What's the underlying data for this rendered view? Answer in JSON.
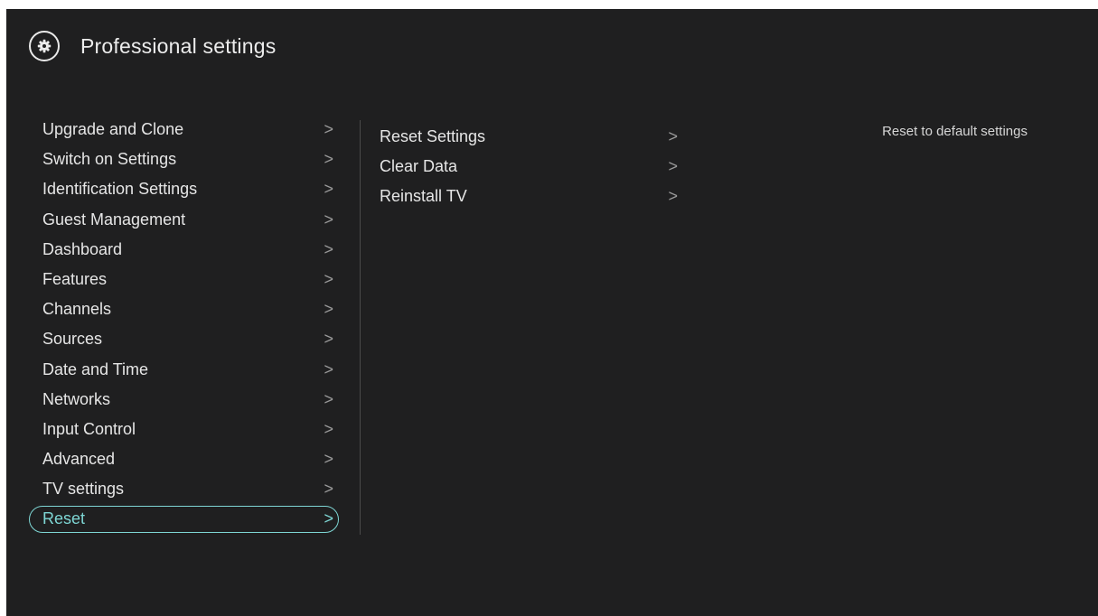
{
  "header": {
    "title": "Professional settings",
    "icon": "gear-icon"
  },
  "menu": {
    "items": [
      {
        "label": "Upgrade and Clone",
        "chevron": ">"
      },
      {
        "label": "Switch on Settings",
        "chevron": ">"
      },
      {
        "label": "Identification Settings",
        "chevron": ">"
      },
      {
        "label": "Guest Management",
        "chevron": ">"
      },
      {
        "label": "Dashboard",
        "chevron": ">"
      },
      {
        "label": "Features",
        "chevron": ">"
      },
      {
        "label": "Channels",
        "chevron": ">"
      },
      {
        "label": "Sources",
        "chevron": ">"
      },
      {
        "label": "Date and Time",
        "chevron": ">"
      },
      {
        "label": "Networks",
        "chevron": ">"
      },
      {
        "label": "Input Control",
        "chevron": ">"
      },
      {
        "label": "Advanced",
        "chevron": ">"
      },
      {
        "label": "TV settings",
        "chevron": ">"
      },
      {
        "label": "Reset",
        "chevron": ">",
        "selected": true
      }
    ]
  },
  "submenu": {
    "items": [
      {
        "label": "Reset Settings",
        "chevron": ">"
      },
      {
        "label": "Clear Data",
        "chevron": ">"
      },
      {
        "label": "Reinstall TV",
        "chevron": ">"
      }
    ]
  },
  "help": {
    "text": "Reset to default settings"
  },
  "colors": {
    "background": "#1f1f20",
    "accent": "#7ed6d4",
    "text": "#e6e6e6",
    "chevron": "#9a9a9a"
  }
}
